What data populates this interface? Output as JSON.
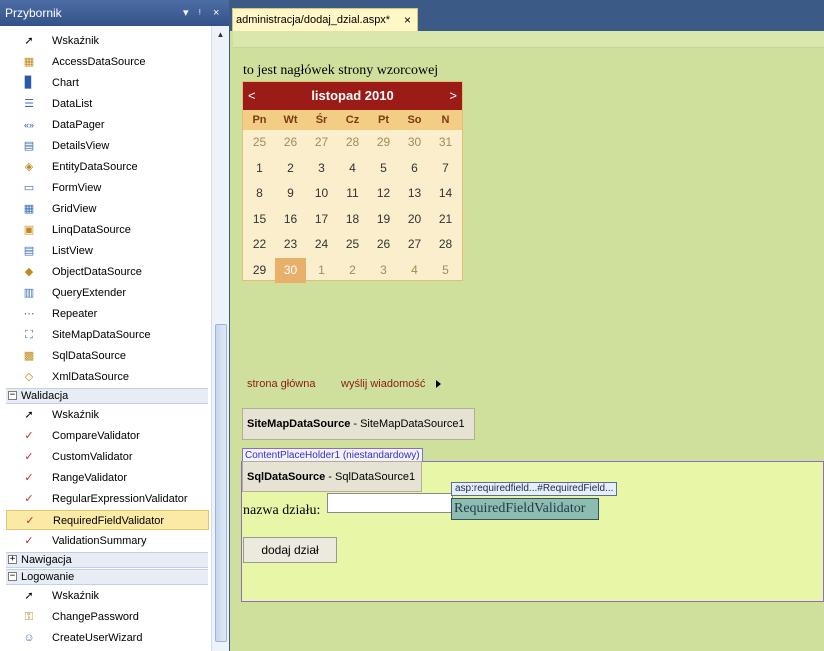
{
  "toolbox": {
    "title": "Przybornik",
    "controls": {
      "dropdown": "▾",
      "pin": "ᵎ",
      "close": "×"
    },
    "items_general": [
      {
        "label": "Wskaźnik",
        "icon": "➚"
      },
      {
        "label": "AccessDataSource",
        "icon": "▦"
      },
      {
        "label": "Chart",
        "icon": "▊"
      },
      {
        "label": "DataList",
        "icon": "☰"
      },
      {
        "label": "DataPager",
        "icon": "«»"
      },
      {
        "label": "DetailsView",
        "icon": "▤"
      },
      {
        "label": "EntityDataSource",
        "icon": "◈"
      },
      {
        "label": "FormView",
        "icon": "▭"
      },
      {
        "label": "GridView",
        "icon": "▦"
      },
      {
        "label": "LinqDataSource",
        "icon": "▣"
      },
      {
        "label": "ListView",
        "icon": "▤"
      },
      {
        "label": "ObjectDataSource",
        "icon": "◆"
      },
      {
        "label": "QueryExtender",
        "icon": "▥"
      },
      {
        "label": "Repeater",
        "icon": "⋯"
      },
      {
        "label": "SiteMapDataSource",
        "icon": "⛶"
      },
      {
        "label": "SqlDataSource",
        "icon": "▩"
      },
      {
        "label": "XmlDataSource",
        "icon": "◇"
      }
    ],
    "cat_walidacja": "Walidacja",
    "items_walidacja": [
      {
        "label": "Wskaźnik",
        "icon": "➚"
      },
      {
        "label": "CompareValidator",
        "icon": "✓"
      },
      {
        "label": "CustomValidator",
        "icon": "✓"
      },
      {
        "label": "RangeValidator",
        "icon": "✓"
      },
      {
        "label": "RegularExpressionValidator",
        "icon": "✓"
      },
      {
        "label": "RequiredFieldValidator",
        "icon": "✓"
      },
      {
        "label": "ValidationSummary",
        "icon": "✓"
      }
    ],
    "cat_nawigacja": "Nawigacja",
    "cat_logowanie": "Logowanie",
    "items_logowanie": [
      {
        "label": "Wskaźnik",
        "icon": "➚"
      },
      {
        "label": "ChangePassword",
        "icon": "⚿"
      },
      {
        "label": "CreateUserWizard",
        "icon": "☺"
      }
    ],
    "plus": "+",
    "minus": "−"
  },
  "tab": {
    "label": "administracja/dodaj_dzial.aspx*",
    "close": "×"
  },
  "page": {
    "header": "to jest nagłówek strony wzorcowej",
    "calendar": {
      "prev": "<",
      "next": ">",
      "title": "listopad 2010",
      "day_names": [
        "Pn",
        "Wt",
        "Śr",
        "Cz",
        "Pt",
        "So",
        "N"
      ],
      "weeks": [
        [
          "25",
          "26",
          "27",
          "28",
          "29",
          "30",
          "31"
        ],
        [
          "1",
          "2",
          "3",
          "4",
          "5",
          "6",
          "7"
        ],
        [
          "8",
          "9",
          "10",
          "11",
          "12",
          "13",
          "14"
        ],
        [
          "15",
          "16",
          "17",
          "18",
          "19",
          "20",
          "21"
        ],
        [
          "22",
          "23",
          "24",
          "25",
          "26",
          "27",
          "28"
        ],
        [
          "29",
          "30",
          "1",
          "2",
          "3",
          "4",
          "5"
        ]
      ]
    },
    "sitemap": {
      "home": "strona główna",
      "send": "wyślij wiadomość"
    },
    "sitemap_ds": {
      "type": "SiteMapDataSource",
      "id": " - SiteMapDataSource1"
    },
    "cph_label": "ContentPlaceHolder1 (niestandardowy)",
    "sql_ds": {
      "type": "SqlDataSource",
      "id": " - SqlDataSource1"
    },
    "nazwa_label": "nazwa działu:",
    "nazwa_value": "",
    "rfv_tag": "asp:requiredfield...#RequiredField...",
    "rfv_text": "RequiredFieldValidator",
    "submit_label": "dodaj dział"
  }
}
